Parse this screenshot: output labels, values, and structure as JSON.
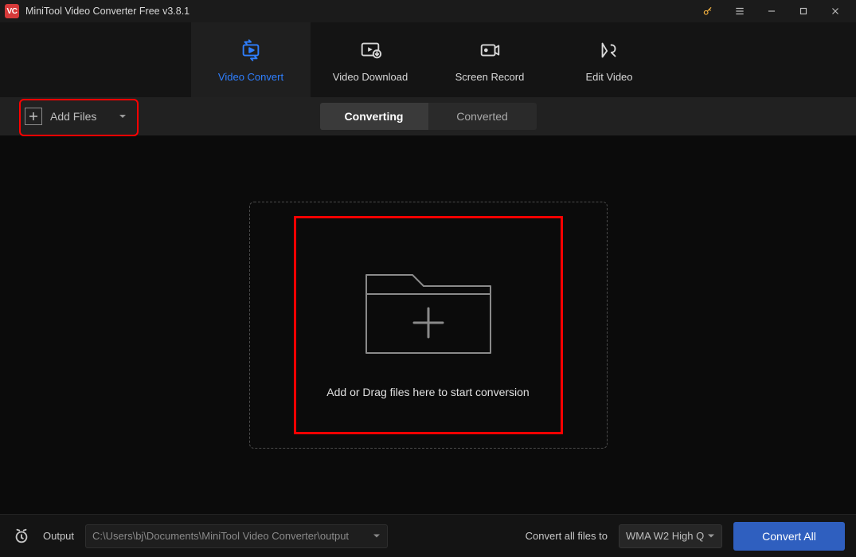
{
  "titlebar": {
    "logo_text": "VC",
    "title": "MiniTool Video Converter Free v3.8.1"
  },
  "tabs": {
    "convert": "Video Convert",
    "download": "Video Download",
    "record": "Screen Record",
    "edit": "Edit Video"
  },
  "toolbar": {
    "add_files": "Add Files",
    "seg_converting": "Converting",
    "seg_converted": "Converted"
  },
  "dropzone": {
    "text": "Add or Drag files here to start conversion"
  },
  "bottombar": {
    "output_label": "Output",
    "output_path": "C:\\Users\\bj\\Documents\\MiniTool Video Converter\\output",
    "convert_to_label": "Convert all files to",
    "format_selected": "WMA W2 High Q",
    "convert_all": "Convert All"
  }
}
